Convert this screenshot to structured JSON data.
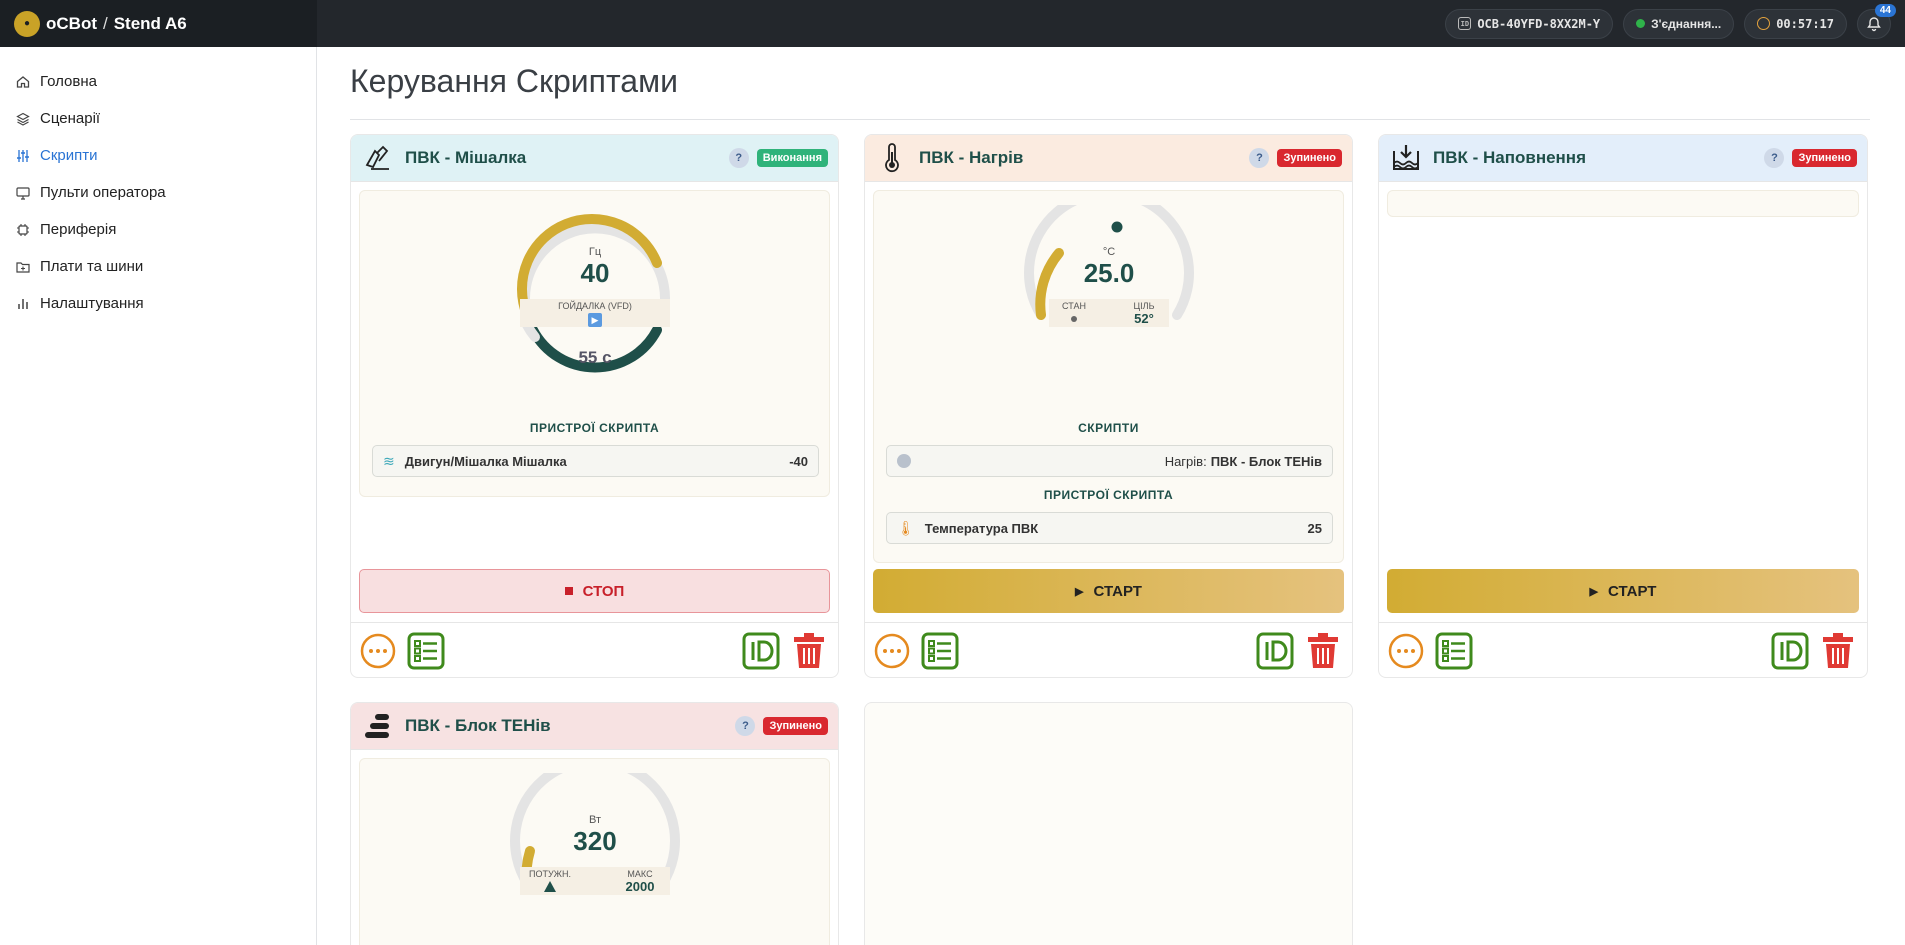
{
  "topbar": {
    "brand": "oCBot",
    "separator": "/",
    "stand": "Stend A6",
    "device_id": "OCB-40YFD-8XX2M-Y",
    "connection_status": "З'єднання...",
    "connection_color": "#2fb34a",
    "timer": "00:57:17",
    "notifications_count": "44"
  },
  "sidebar": {
    "items": [
      {
        "label": "Головна",
        "icon": "home-icon"
      },
      {
        "label": "Сценарії",
        "icon": "layers-icon"
      },
      {
        "label": "Скрипти",
        "icon": "sliders-icon",
        "active": true
      },
      {
        "label": "Пульти оператора",
        "icon": "monitor-icon"
      },
      {
        "label": "Периферія",
        "icon": "chip-icon"
      },
      {
        "label": "Плати та шини",
        "icon": "folder-plus-icon"
      },
      {
        "label": "Налаштування",
        "icon": "bar-chart-icon"
      }
    ]
  },
  "main": {
    "title": "Керування Скриптами"
  },
  "cards": {
    "mixer": {
      "title": "ПВК - Мішалка",
      "help": "?",
      "state": "Виконання",
      "gauge_unit": "Гц",
      "gauge_value": "40",
      "gauge_mode": "ГОЙДАЛКА (VFD)",
      "gauge_level": 0.8,
      "timer_value": "55 с",
      "devices_label": "ПРИСТРОЇ СКРИПТА",
      "device_name": "Двигун/Мішалка Мішалка",
      "device_value": "-40",
      "stop_label": "СТОП"
    },
    "heating": {
      "title": "ПВК - Нагрів",
      "help": "?",
      "state": "Зупинено",
      "gauge_unit": "°C",
      "gauge_value": "25.0",
      "state_label": "СТАН",
      "target_label": "ЦІЛЬ",
      "target_value": "52°",
      "scripts_label": "СКРИПТИ",
      "script_prefix": "Нагрів:",
      "script_name": "ПВК - Блок ТЕНів",
      "devices_label": "ПРИСТРОЇ СКРИПТА",
      "device_name": "Температура ПВК",
      "device_value": "25",
      "start_label": "СТАРТ"
    },
    "filling": {
      "title": "ПВК - Наповнення",
      "help": "?",
      "state": "Зупинено",
      "start_label": "СТАРТ"
    },
    "heaters": {
      "title": "ПВК - Блок ТЕНів",
      "help": "?",
      "state": "Зупинено",
      "gauge_unit": "Вт",
      "gauge_value": "320",
      "power_label": "ПОТУЖН.",
      "max_label": "МАКС",
      "max_value": "2000"
    }
  },
  "colors": {
    "accent": "#2a74d4",
    "gold": "#d2ac33",
    "dark_green": "#1f4f49",
    "running": "#2fb37a",
    "stopped": "#d9282f"
  }
}
